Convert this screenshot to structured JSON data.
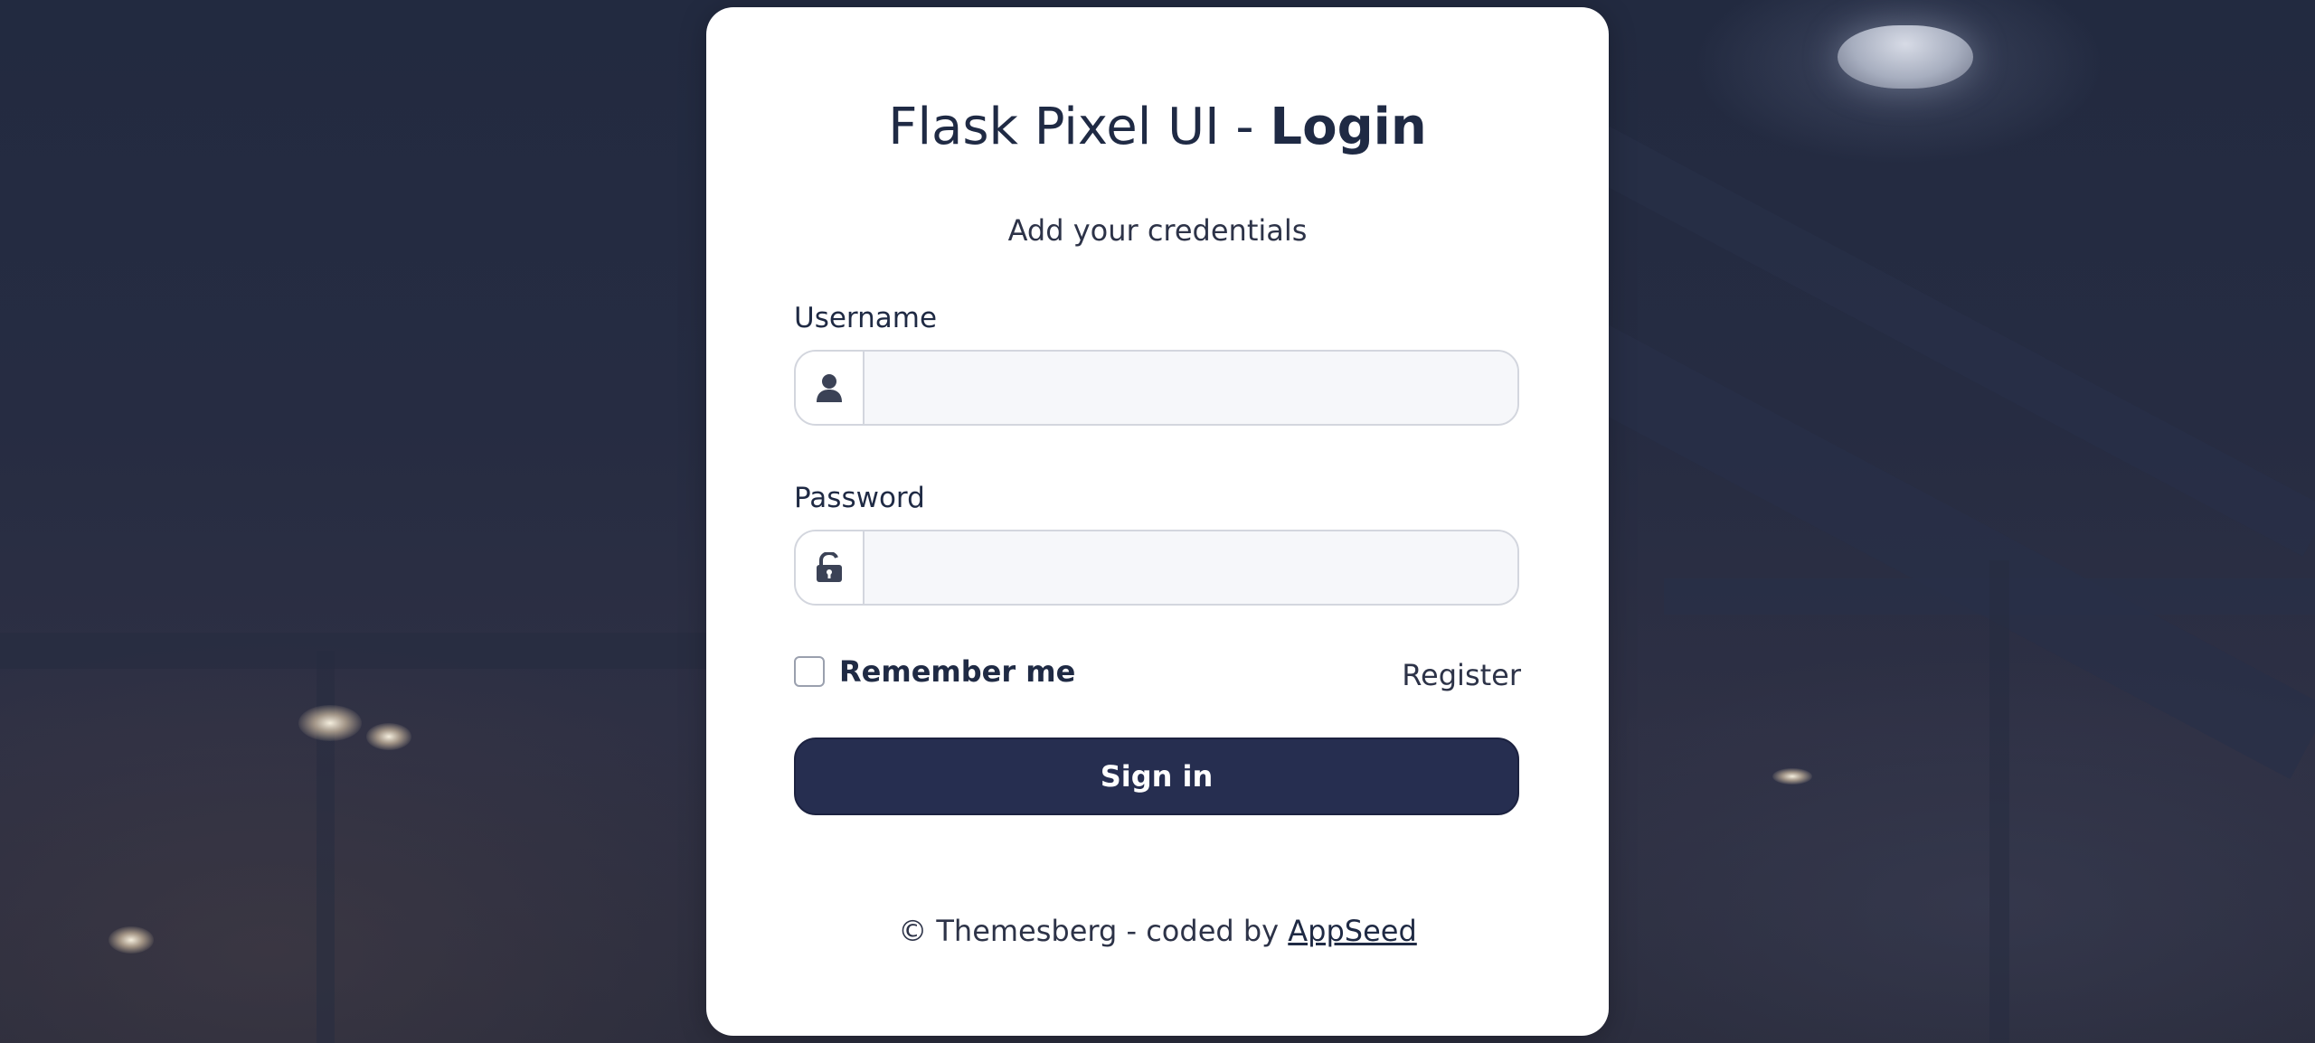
{
  "card": {
    "title_prefix": "Flask Pixel UI - ",
    "title_strong": "Login",
    "subtitle": "Add your credentials"
  },
  "form": {
    "username_label": "Username",
    "username_icon": "user-icon",
    "username_value": "",
    "password_label": "Password",
    "password_icon": "unlock-icon",
    "password_value": "",
    "remember_label": "Remember me",
    "remember_checked": false,
    "register_link": "Register",
    "signin_button": "Sign in"
  },
  "footer": {
    "text": "© Themesberg - coded by ",
    "link_text": "AppSeed"
  },
  "colors": {
    "primary": "#262e50",
    "text": "#1f2a44",
    "input_bg": "#f6f7fa",
    "border": "#d3d6de"
  }
}
